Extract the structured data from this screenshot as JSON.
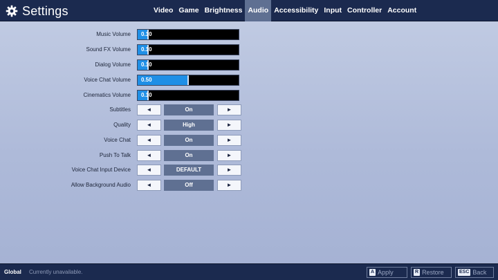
{
  "header": {
    "title": "Settings",
    "icon": "gear-icon",
    "tabs": [
      {
        "label": "Video",
        "active": false
      },
      {
        "label": "Game",
        "active": false
      },
      {
        "label": "Brightness",
        "active": false
      },
      {
        "label": "Audio",
        "active": true
      },
      {
        "label": "Accessibility",
        "active": false
      },
      {
        "label": "Input",
        "active": false
      },
      {
        "label": "Controller",
        "active": false
      },
      {
        "label": "Account",
        "active": false
      }
    ]
  },
  "settings": {
    "music_volume": {
      "label": "Music Volume",
      "value": "0.10",
      "level": 0.1
    },
    "sound_fx_volume": {
      "label": "Sound FX Volume",
      "value": "0.10",
      "level": 0.1
    },
    "dialog_volume": {
      "label": "Dialog Volume",
      "value": "0.10",
      "level": 0.1
    },
    "voice_chat_volume": {
      "label": "Voice Chat Volume",
      "value": "0.50",
      "level": 0.5
    },
    "cinematics_volume": {
      "label": "Cinematics Volume",
      "value": "0.10",
      "level": 0.1
    },
    "subtitles": {
      "label": "Subtitles",
      "value": "On"
    },
    "quality": {
      "label": "Quality",
      "value": "High"
    },
    "voice_chat": {
      "label": "Voice Chat",
      "value": "On"
    },
    "push_to_talk": {
      "label": "Push To Talk",
      "value": "On"
    },
    "voice_chat_input_device": {
      "label": "Voice Chat Input Device",
      "value": "DEFAULT"
    },
    "allow_background_audio": {
      "label": "Allow Background Audio",
      "value": "Off"
    }
  },
  "arrows": {
    "left": "◄",
    "right": "►"
  },
  "footer": {
    "scope": "Global",
    "status": "Currently unavailable.",
    "apply": {
      "key": "A",
      "label": "Apply"
    },
    "restore": {
      "key": "R",
      "label": "Restore"
    },
    "back": {
      "key": "ESC",
      "label": "Back"
    }
  },
  "colors": {
    "header_bg": "#1b2a4f",
    "active_tab": "#5f7092",
    "slider_fill": "#1f8fe6",
    "value_box": "#5f7092",
    "background": "#b4c0dd"
  }
}
